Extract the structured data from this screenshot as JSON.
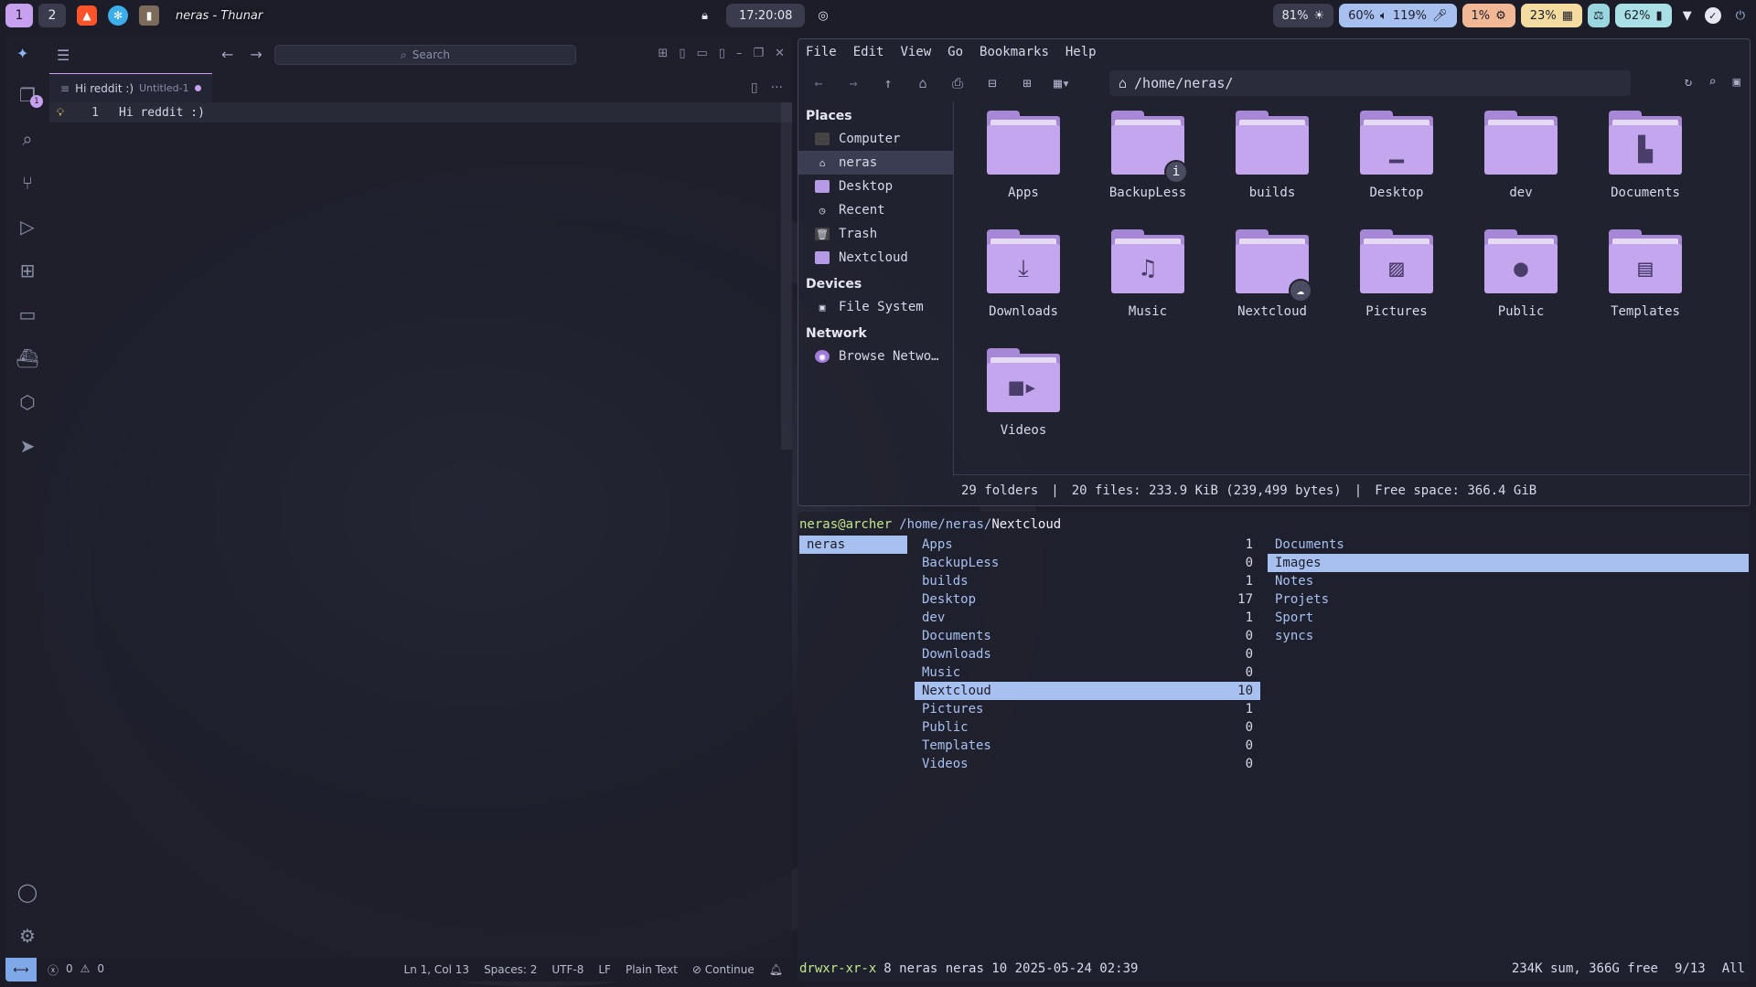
{
  "topbar": {
    "workspaces": [
      "1",
      "2"
    ],
    "window_title": "neras - Thunar",
    "clock": "17:20:08",
    "brightness": "81%",
    "volume": "60%",
    "mic": "119%",
    "cpu": "1%",
    "memory": "23%",
    "battery": "62%"
  },
  "vscode": {
    "search_placeholder": "Search",
    "tab": {
      "title": "Hi reddit :)",
      "hint": "Untitled-1"
    },
    "lines": [
      {
        "number": "1",
        "text": "Hi reddit :)"
      }
    ],
    "source_control_badge": "1",
    "status": {
      "errors": "0",
      "warnings": "0",
      "position": "Ln 1, Col 13",
      "spaces": "Spaces: 2",
      "encoding": "UTF-8",
      "eol": "LF",
      "language": "Plain Text",
      "continue": "Continue"
    }
  },
  "thunar": {
    "menu": [
      "File",
      "Edit",
      "View",
      "Go",
      "Bookmarks",
      "Help"
    ],
    "path": "/home/neras/",
    "sidebar": {
      "places_title": "Places",
      "places": [
        "Computer",
        "neras",
        "Desktop",
        "Recent",
        "Trash",
        "Nextcloud"
      ],
      "devices_title": "Devices",
      "devices": [
        "File System"
      ],
      "network_title": "Network",
      "network": [
        "Browse Netwo…"
      ]
    },
    "items": [
      "Apps",
      "BackupLess",
      "builds",
      "Desktop",
      "dev",
      "Documents",
      "Downloads",
      "Music",
      "Nextcloud",
      "Pictures",
      "Public",
      "Templates",
      "Videos"
    ],
    "status": {
      "folders": "29 folders",
      "files": "20 files: 233.9 KiB (239,499 bytes)",
      "free": "Free space: 366.4 GiB"
    }
  },
  "terminal": {
    "user_host": "neras@archer",
    "path_prefix": "/home/neras/",
    "path_current": "Nextcloud",
    "parent": [
      "neras"
    ],
    "entries": [
      {
        "name": "Apps",
        "count": "1"
      },
      {
        "name": "BackupLess",
        "count": "0"
      },
      {
        "name": "builds",
        "count": "1"
      },
      {
        "name": "Desktop",
        "count": "17"
      },
      {
        "name": "dev",
        "count": "1"
      },
      {
        "name": "Documents",
        "count": "0"
      },
      {
        "name": "Downloads",
        "count": "0"
      },
      {
        "name": "Music",
        "count": "0"
      },
      {
        "name": "Nextcloud",
        "count": "10"
      },
      {
        "name": "Pictures",
        "count": "1"
      },
      {
        "name": "Public",
        "count": "0"
      },
      {
        "name": "Templates",
        "count": "0"
      },
      {
        "name": "Videos",
        "count": "0"
      }
    ],
    "preview": [
      "Documents",
      "Images",
      "Notes",
      "Projets",
      "Sport",
      "syncs"
    ],
    "status": {
      "permissions": "drwxr-xr-x",
      "info": "8 neras neras 10 2025-05-24 02:39",
      "sum": "234K sum, 366G free",
      "position": "9/13",
      "all": "All"
    }
  }
}
